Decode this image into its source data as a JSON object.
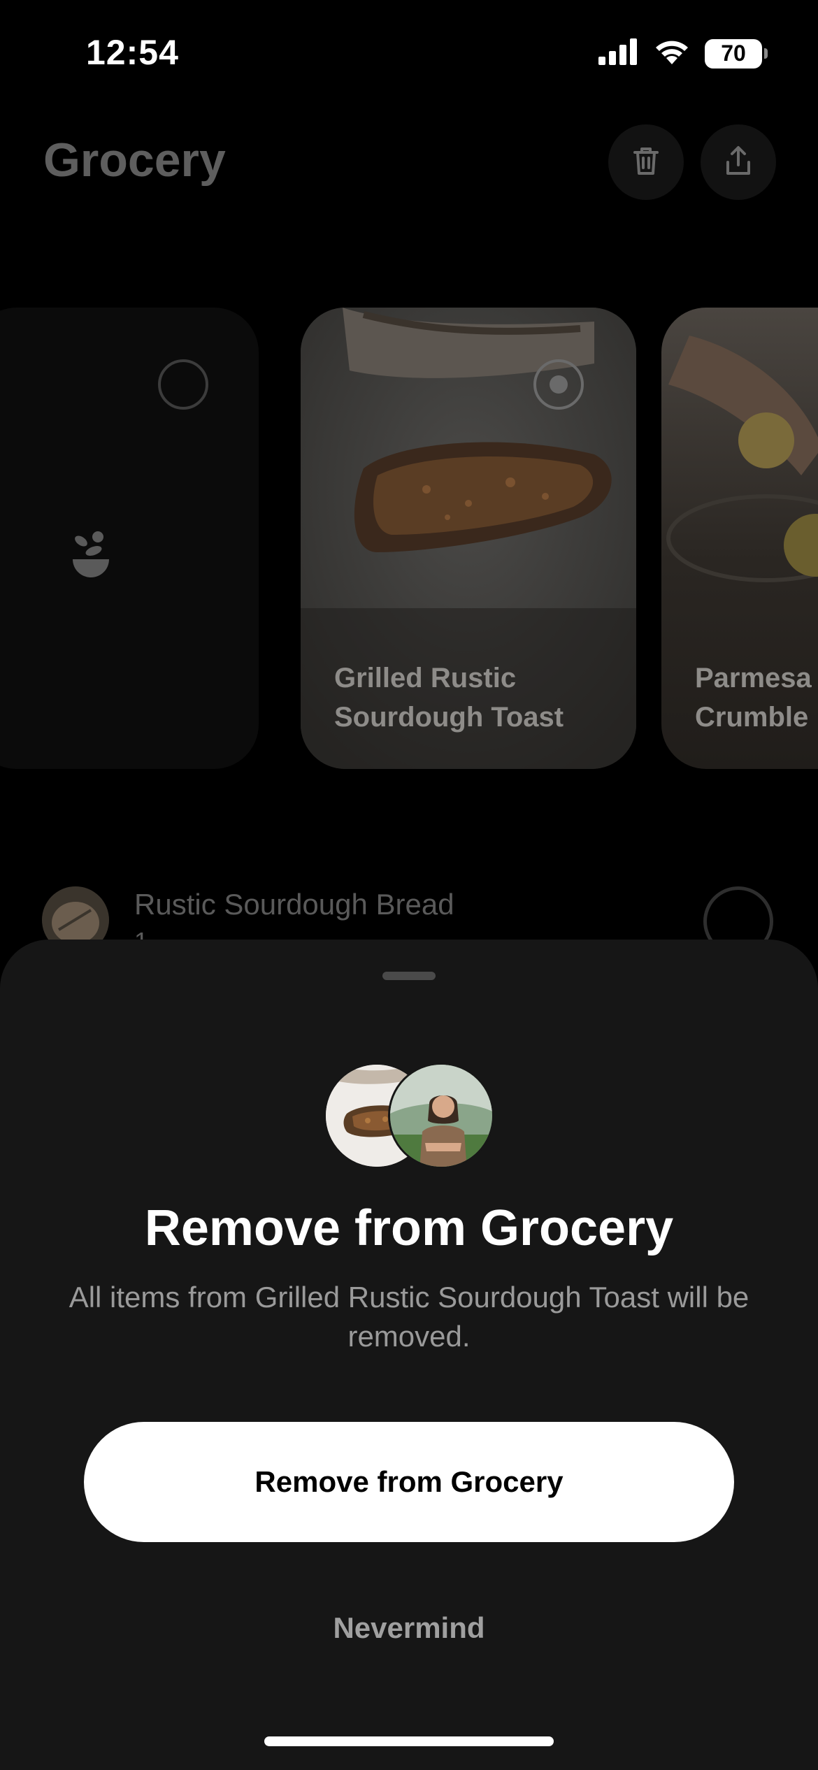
{
  "status_bar": {
    "time": "12:54",
    "battery": "70",
    "icons": [
      "cellular-signal-icon",
      "wifi-icon",
      "battery-icon"
    ]
  },
  "header": {
    "title": "Grocery",
    "actions": [
      "trash-icon",
      "share-icon"
    ]
  },
  "recipe_cards": [
    {
      "title": "",
      "icon": "bowl-icon",
      "selected": false
    },
    {
      "title": "Grilled Rustic Sourdough Toast",
      "selected": true
    },
    {
      "title": "Parmesa\nCrumble",
      "selected": false
    }
  ],
  "grocery_items": [
    {
      "name": "Rustic Sourdough Bread",
      "quantity": "1"
    }
  ],
  "sheet": {
    "title": "Remove from Grocery",
    "description": "All items from Grilled Rustic Sourdough Toast will be removed.",
    "confirm_label": "Remove from Grocery",
    "cancel_label": "Nevermind"
  },
  "colors": {
    "background": "#000000",
    "sheet": "#161616",
    "primary_button": "#ffffff",
    "muted_text": "#9a9a9a"
  }
}
